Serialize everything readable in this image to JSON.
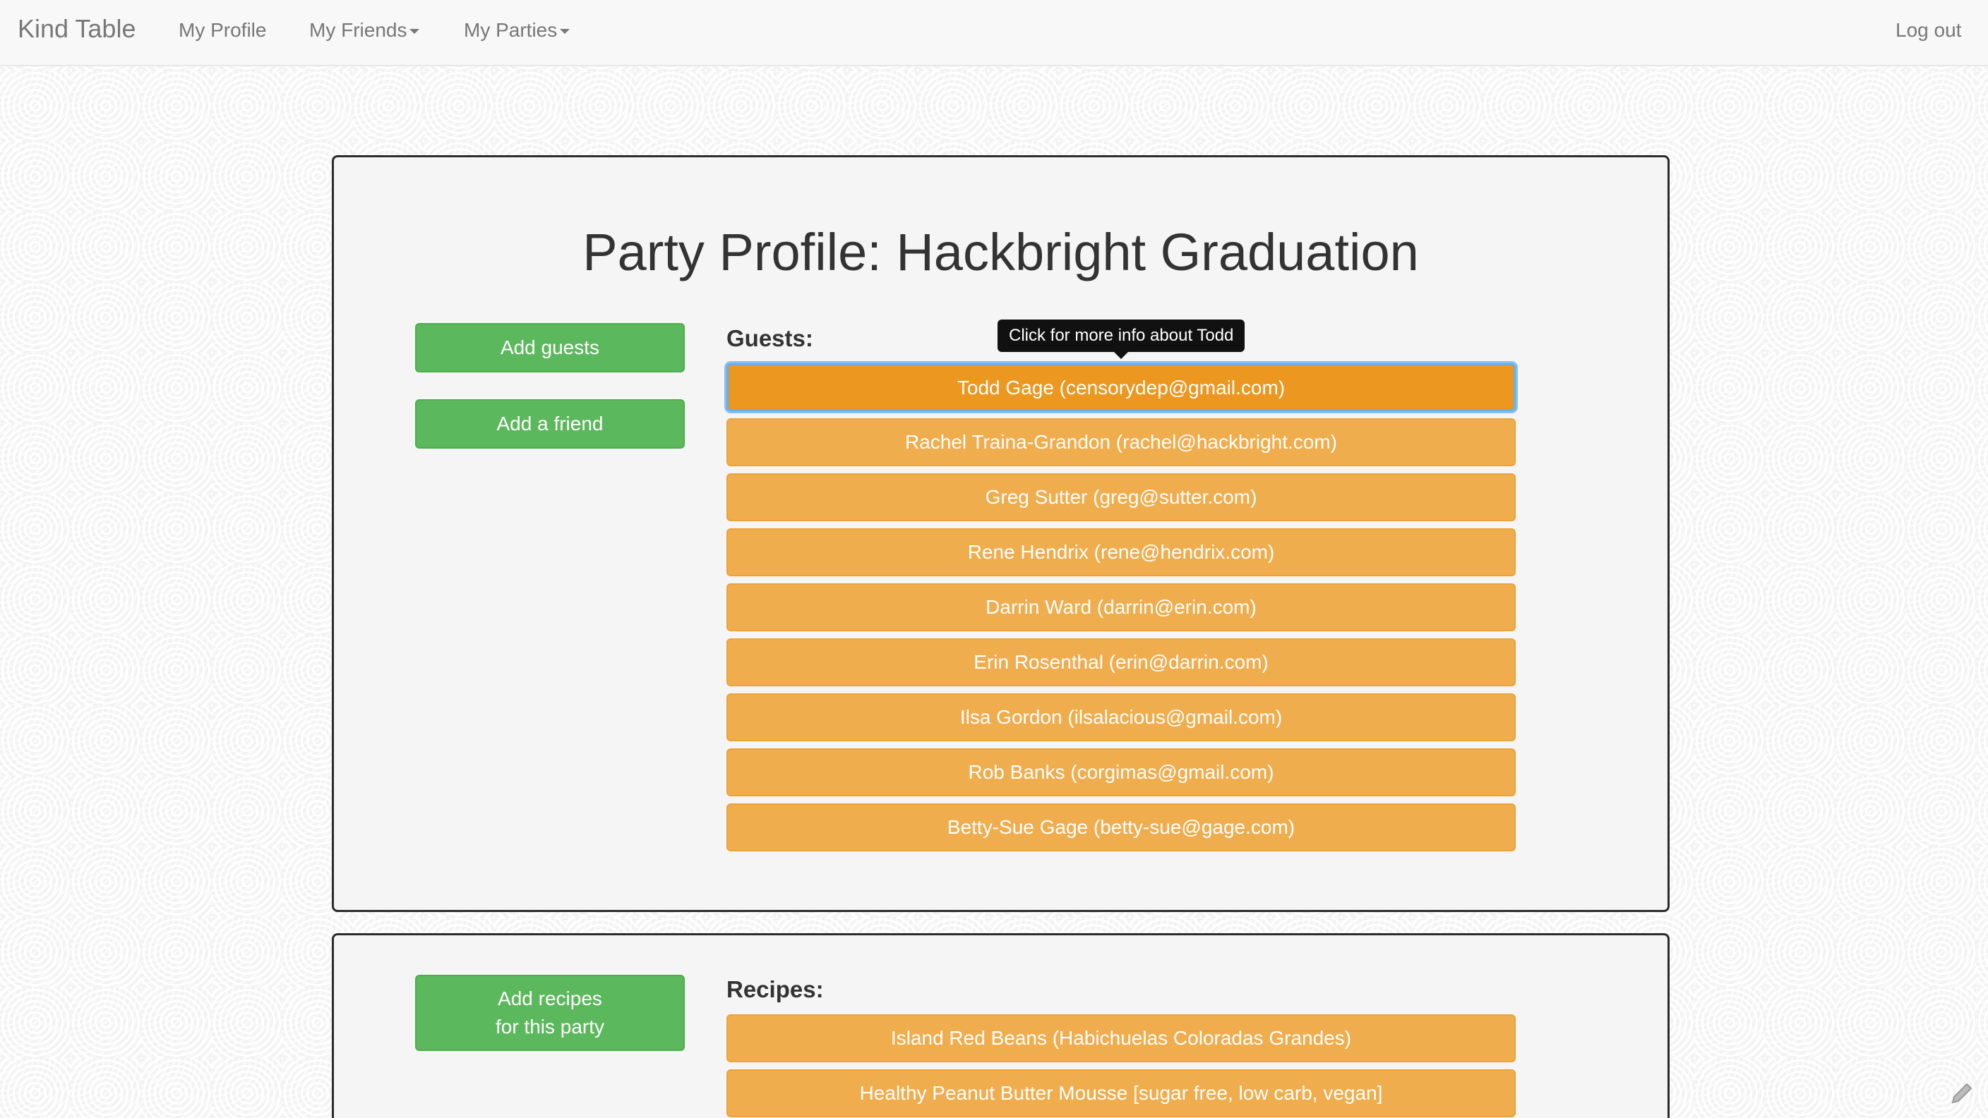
{
  "nav": {
    "brand": "Kind Table",
    "my_profile": "My Profile",
    "my_friends": "My Friends",
    "my_parties": "My Parties",
    "logout": "Log out"
  },
  "party": {
    "title": "Party Profile: Hackbright Graduation",
    "add_guests_label": "Add guests",
    "add_friend_label": "Add a friend",
    "guests_heading": "Guests:",
    "tooltip": "Click for more info about Todd",
    "guests": [
      "Todd Gage (censorydep@gmail.com)",
      "Rachel Traina-Grandon (rachel@hackbright.com)",
      "Greg Sutter (greg@sutter.com)",
      "Rene Hendrix (rene@hendrix.com)",
      "Darrin Ward (darrin@erin.com)",
      "Erin Rosenthal (erin@darrin.com)",
      "Ilsa Gordon (ilsalacious@gmail.com)",
      "Rob Banks (corgimas@gmail.com)",
      "Betty-Sue Gage (betty-sue@gage.com)"
    ]
  },
  "recipes": {
    "add_recipes_line1": "Add recipes",
    "add_recipes_line2": "for this party",
    "heading": "Recipes:",
    "items": [
      "Island Red Beans (Habichuelas Coloradas Grandes)",
      "Healthy Peanut Butter Mousse [sugar free, low carb, vegan]"
    ]
  },
  "colors": {
    "green_button": "#5cb85c",
    "orange_button": "#f0ad4e",
    "orange_active": "#ec971f"
  }
}
